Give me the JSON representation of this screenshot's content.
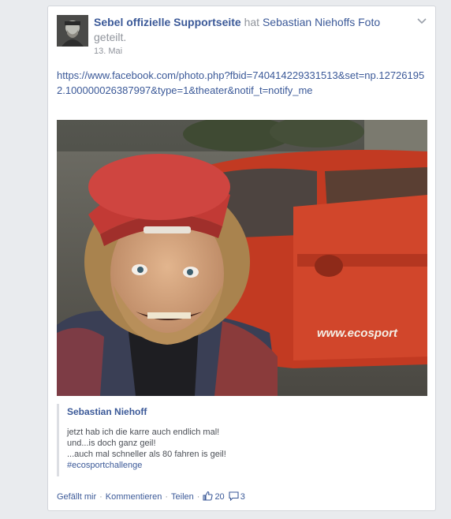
{
  "post": {
    "page_name": "Sebel offizielle Supportseite",
    "shared_word": "hat",
    "photo_owner": "Sebastian Niehoffs Foto",
    "shared_suffix": "geteilt.",
    "date": "13. Mai",
    "url_text": "https://www.facebook.com/photo.php?fbid=740414229331513&set=np.127261952.100000026387997&type=1&theater&notif_t=notify_me",
    "photo_sign_text": "www.ecosport"
  },
  "quote": {
    "author": "Sebastian Niehoff",
    "lines": [
      "jetzt hab ich die karre auch endlich mal!",
      "und...is doch ganz geil!",
      "...auch mal schneller als 80 fahren is geil!"
    ],
    "hashtag": "#ecosportchallenge"
  },
  "actions": {
    "like_label": "Gefällt mir",
    "comment_label": "Kommentieren",
    "share_label": "Teilen",
    "separator": "·",
    "likes_count": "20",
    "comments_count": "3",
    "like_icon": "thumbs-up-icon",
    "comment_icon": "speech-bubble-icon"
  },
  "colors": {
    "link": "#3b5998",
    "muted": "#90949c",
    "page_bg": "#e9ebee",
    "car_red": "#c0392b"
  }
}
